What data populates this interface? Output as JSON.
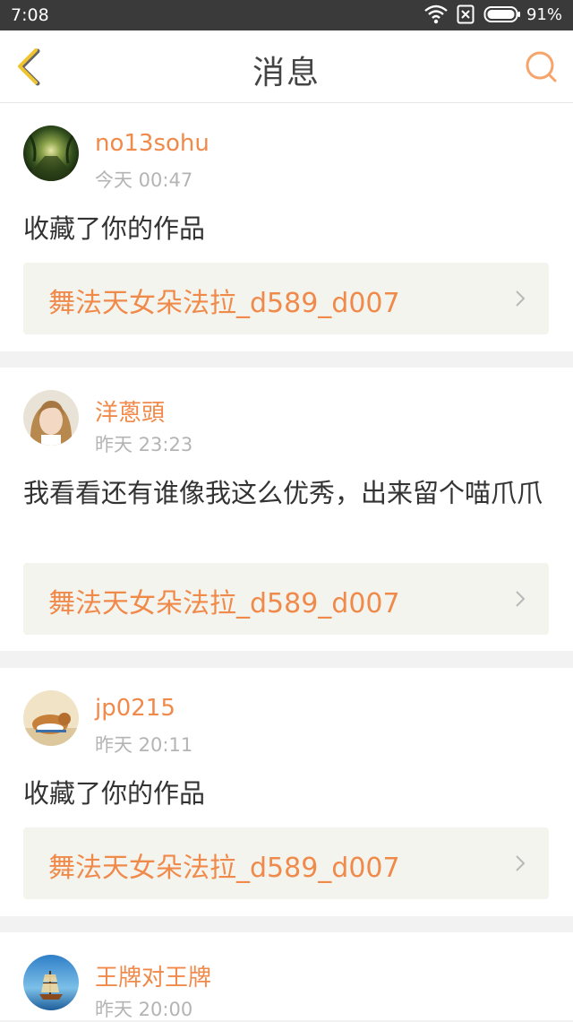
{
  "status_bar": {
    "time": "7:08",
    "battery": "91%",
    "icons": [
      "wifi-icon",
      "no-sim-icon",
      "battery-icon"
    ]
  },
  "header": {
    "title": "消息",
    "back_icon": "chevron-left-icon",
    "search_icon": "search-icon"
  },
  "colors": {
    "accent": "#f08a4b",
    "back_icon": "#f0c42f",
    "link_bg": "#f4f4ee",
    "page_bg": "#f2f2f2"
  },
  "messages": [
    {
      "username": "no13sohu",
      "time": "今天 00:47",
      "text": "收藏了你的作品",
      "work_title": "舞法天女朵法拉_d589_d007"
    },
    {
      "username": "洋蔥頭",
      "time": "昨天 23:23",
      "text": "我看看还有谁像我这么优秀，出来留个喵爪爪",
      "work_title": "舞法天女朵法拉_d589_d007"
    },
    {
      "username": "jp0215",
      "time": "昨天 20:11",
      "text": "收藏了你的作品",
      "work_title": "舞法天女朵法拉_d589_d007"
    },
    {
      "username": "王牌对王牌",
      "time": "昨天 20:00"
    }
  ]
}
